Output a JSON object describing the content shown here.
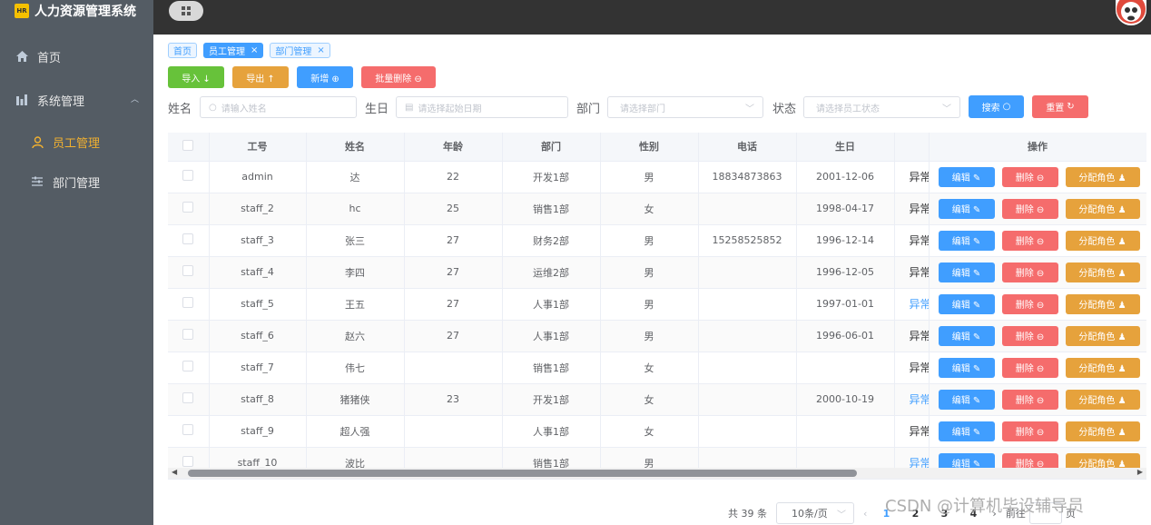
{
  "app": {
    "title": "人力资源管理系统",
    "badge": "HR"
  },
  "sidebar": {
    "items": [
      {
        "label": "首页"
      },
      {
        "label": "系统管理"
      },
      {
        "label": "员工管理"
      },
      {
        "label": "部门管理"
      }
    ]
  },
  "tabs": [
    {
      "label": "首页"
    },
    {
      "label": "员工管理"
    },
    {
      "label": "部门管理"
    }
  ],
  "toolbar": {
    "import_label": "导入 ↓",
    "export_label": "导出 ↑",
    "add_label": "新增 ⊕",
    "batch_delete_label": "批量删除 ⊖"
  },
  "filters": {
    "name_label": "姓名",
    "name_placeholder": "请输入姓名",
    "birthday_label": "生日",
    "birthday_placeholder": "请选择起始日期",
    "dept_label": "部门",
    "dept_placeholder": "请选择部门",
    "status_label": "状态",
    "status_placeholder": "请选择员工状态",
    "search_label": "搜索",
    "reset_label": "重置"
  },
  "table": {
    "columns": [
      "工号",
      "姓名",
      "年龄",
      "部门",
      "性别",
      "电话",
      "生日",
      "",
      "操作"
    ],
    "rows": [
      {
        "id": "admin",
        "name": "达",
        "age": "22",
        "dept": "开发1部",
        "gender": "男",
        "phone": "18834873863",
        "birthday": "2001-12-06",
        "state": "异常",
        "state_color": "#303133"
      },
      {
        "id": "staff_2",
        "name": "hc",
        "age": "25",
        "dept": "销售1部",
        "gender": "女",
        "phone": "",
        "birthday": "1998-04-17",
        "state": "异常",
        "state_color": "#303133"
      },
      {
        "id": "staff_3",
        "name": "张三",
        "age": "27",
        "dept": "财务2部",
        "gender": "男",
        "phone": "15258525852",
        "birthday": "1996-12-14",
        "state": "异常",
        "state_color": "#303133"
      },
      {
        "id": "staff_4",
        "name": "李四",
        "age": "27",
        "dept": "运维2部",
        "gender": "男",
        "phone": "",
        "birthday": "1996-12-05",
        "state": "异常",
        "state_color": "#303133"
      },
      {
        "id": "staff_5",
        "name": "王五",
        "age": "27",
        "dept": "人事1部",
        "gender": "男",
        "phone": "",
        "birthday": "1997-01-01",
        "state": "异常",
        "state_color": "#409eff"
      },
      {
        "id": "staff_6",
        "name": "赵六",
        "age": "27",
        "dept": "人事1部",
        "gender": "男",
        "phone": "",
        "birthday": "1996-06-01",
        "state": "异常",
        "state_color": "#303133"
      },
      {
        "id": "staff_7",
        "name": "伟七",
        "age": "",
        "dept": "销售1部",
        "gender": "女",
        "phone": "",
        "birthday": "",
        "state": "异常",
        "state_color": "#303133"
      },
      {
        "id": "staff_8",
        "name": "猪猪侠",
        "age": "23",
        "dept": "开发1部",
        "gender": "女",
        "phone": "",
        "birthday": "2000-10-19",
        "state": "异常",
        "state_color": "#409eff"
      },
      {
        "id": "staff_9",
        "name": "超人强",
        "age": "",
        "dept": "人事1部",
        "gender": "女",
        "phone": "",
        "birthday": "",
        "state": "异常",
        "state_color": "#303133"
      },
      {
        "id": "staff_10",
        "name": "波比",
        "age": "",
        "dept": "销售1部",
        "gender": "男",
        "phone": "",
        "birthday": "",
        "state": "异常",
        "state_color": "#409eff"
      }
    ],
    "ops": {
      "edit": "编辑 ✎",
      "delete": "删除 ⊖",
      "assign_role": "分配角色 ♟"
    }
  },
  "pagination": {
    "total_text": "共 39 条",
    "page_size": "10条/页",
    "pages": [
      "1",
      "2",
      "3",
      "4"
    ],
    "goto_label": "前往",
    "goto_suffix": "页"
  },
  "watermark": "CSDN @计算机毕设辅导员",
  "colors": {
    "sidebar": "#545c64",
    "accent": "#409eff",
    "active_menu": "#f0b030"
  }
}
